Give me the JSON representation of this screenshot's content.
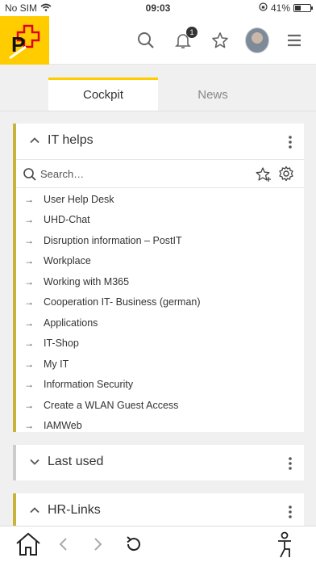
{
  "status": {
    "carrier": "No SIM",
    "time": "09:03",
    "battery": "41%",
    "battery_level": 0.41
  },
  "header": {
    "logo": "Swiss Post logo",
    "icons": [
      "search-icon",
      "bell-icon",
      "star-icon",
      "avatar",
      "menu-icon"
    ],
    "notification_count": "1"
  },
  "tabs": [
    {
      "label": "Cockpit",
      "active": true
    },
    {
      "label": "News",
      "active": false
    }
  ],
  "colors": {
    "brand_yellow": "#ffcc00",
    "accent_bar": "#c8b43a",
    "inactive_bar": "#cccccc"
  },
  "it_helps": {
    "title": "IT helps",
    "search_placeholder": "Search…",
    "links": [
      "User Help Desk",
      "UHD-Chat",
      "Disruption information – PostIT",
      "Workplace",
      "Working with M365",
      "Cooperation IT- Business (german)",
      "Applications",
      "IT-Shop",
      "My IT",
      "Information Security",
      "Create a WLAN Guest Access",
      "IAMWeb"
    ]
  },
  "last_used": {
    "title": "Last used"
  },
  "hr_links": {
    "title": "HR-Links"
  }
}
